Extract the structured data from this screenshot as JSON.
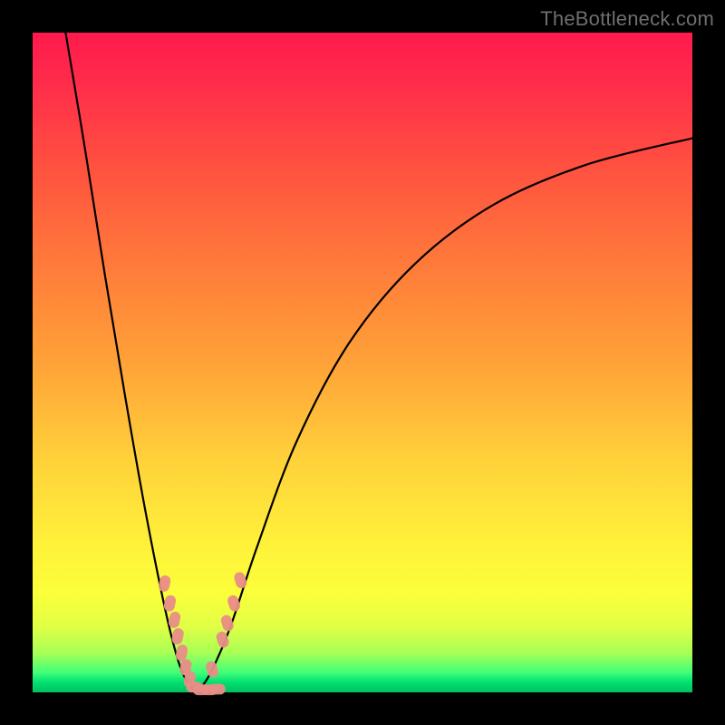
{
  "watermark": "TheBottleneck.com",
  "colors": {
    "curve": "#000000",
    "markers": "#e98d87",
    "marker_stroke": "#e98d87"
  },
  "chart_data": {
    "type": "line",
    "title": "",
    "xlabel": "",
    "ylabel": "",
    "xlim": [
      0,
      100
    ],
    "ylim": [
      0,
      100
    ],
    "grid": false,
    "legend": false,
    "note": "Axes are unlabeled percentages; y=0 (green) is optimal match, higher y (red) is worse bottleneck. Values estimated from pixel positions.",
    "series": [
      {
        "name": "bottleneck-curve-left",
        "x": [
          5,
          8,
          11,
          14,
          17,
          20,
          22,
          23.5,
          25
        ],
        "y": [
          100,
          82,
          63,
          45,
          28,
          13,
          5,
          1.5,
          0
        ]
      },
      {
        "name": "bottleneck-curve-right",
        "x": [
          25,
          27,
          30,
          34,
          40,
          48,
          58,
          70,
          84,
          100
        ],
        "y": [
          0,
          3,
          10,
          22,
          38,
          53,
          65,
          74,
          80,
          84
        ]
      }
    ],
    "markers": {
      "name": "highlighted-points",
      "style": "rounded-pill",
      "points": [
        {
          "x": 20.0,
          "y": 16.5
        },
        {
          "x": 20.8,
          "y": 13.5
        },
        {
          "x": 21.5,
          "y": 11.0
        },
        {
          "x": 22.0,
          "y": 8.5
        },
        {
          "x": 22.6,
          "y": 6.0
        },
        {
          "x": 23.2,
          "y": 3.8
        },
        {
          "x": 23.8,
          "y": 2.0
        },
        {
          "x": 24.5,
          "y": 0.8
        },
        {
          "x": 25.5,
          "y": 0.4
        },
        {
          "x": 26.8,
          "y": 0.4
        },
        {
          "x": 28.0,
          "y": 0.5
        },
        {
          "x": 27.2,
          "y": 3.5
        },
        {
          "x": 28.8,
          "y": 8.0
        },
        {
          "x": 29.5,
          "y": 10.5
        },
        {
          "x": 30.5,
          "y": 13.5
        },
        {
          "x": 31.5,
          "y": 17.0
        }
      ]
    }
  }
}
